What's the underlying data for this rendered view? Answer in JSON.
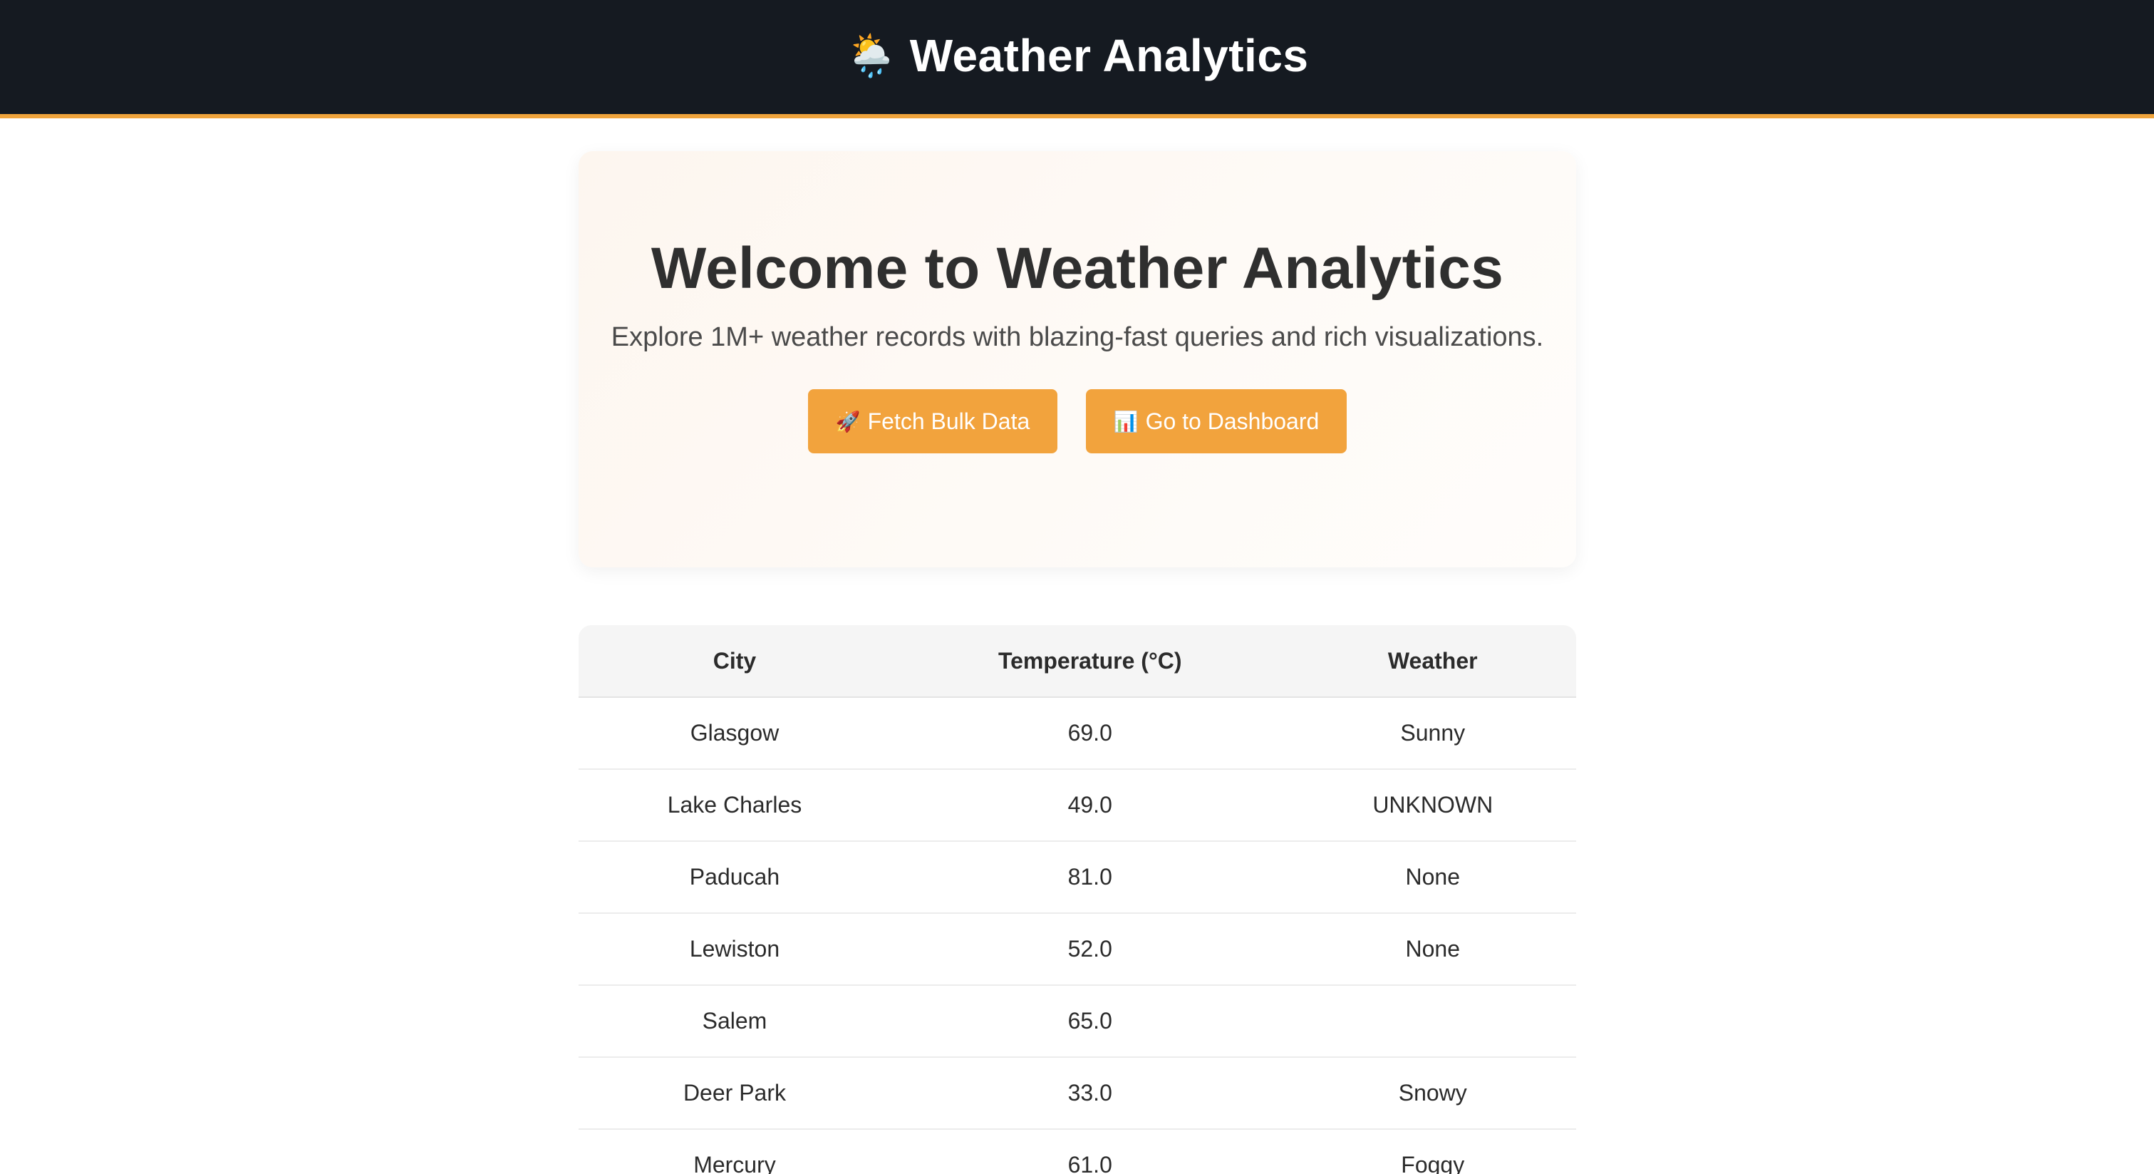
{
  "header": {
    "icon": "sun-behind-rain-cloud-icon",
    "icon_glyph": "🌦️",
    "title": "Weather Analytics",
    "accent_color": "#f0a43c",
    "background_color": "#151a21"
  },
  "hero": {
    "heading": "Welcome to Weather Analytics",
    "subtitle": "Explore 1M+ weather records with blazing-fast queries and rich visualizations.",
    "buttons": [
      {
        "icon": "rocket-icon",
        "icon_glyph": "🚀",
        "label": "Fetch Bulk Data"
      },
      {
        "icon": "bar-chart-icon",
        "icon_glyph": "📊",
        "label": "Go to Dashboard"
      }
    ],
    "button_color": "#f2a33d"
  },
  "table": {
    "columns": [
      "City",
      "Temperature (°C)",
      "Weather"
    ],
    "rows": [
      {
        "city": "Glasgow",
        "temperature": "69.0",
        "weather": "Sunny"
      },
      {
        "city": "Lake Charles",
        "temperature": "49.0",
        "weather": "UNKNOWN"
      },
      {
        "city": "Paducah",
        "temperature": "81.0",
        "weather": "None"
      },
      {
        "city": "Lewiston",
        "temperature": "52.0",
        "weather": "None"
      },
      {
        "city": "Salem",
        "temperature": "65.0",
        "weather": ""
      },
      {
        "city": "Deer Park",
        "temperature": "33.0",
        "weather": "Snowy"
      },
      {
        "city": "Mercury",
        "temperature": "61.0",
        "weather": "Foggy"
      }
    ]
  }
}
